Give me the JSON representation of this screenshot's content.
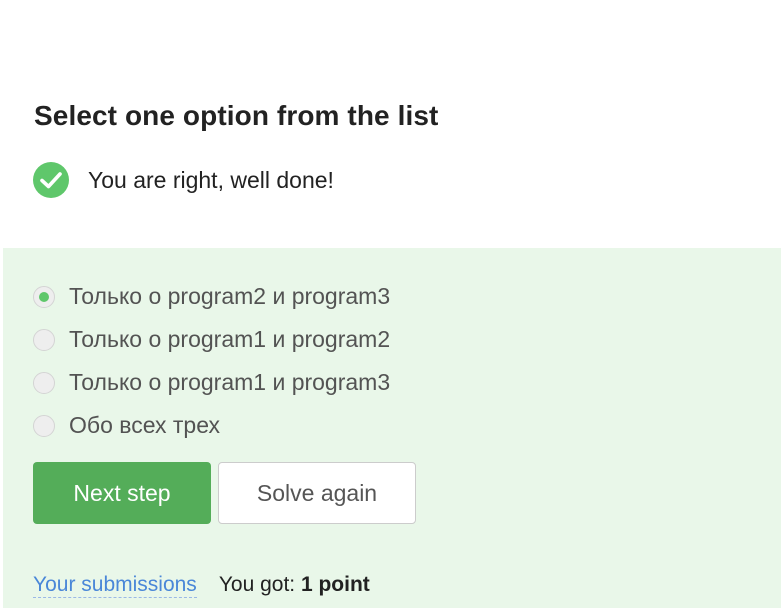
{
  "quiz": {
    "title": "Select one option from the list",
    "feedback": "You are right, well done!",
    "options": [
      {
        "label": "Только о program2 и program3",
        "selected": true
      },
      {
        "label": "Только о program1 и program2",
        "selected": false
      },
      {
        "label": "Только о program1 и program3",
        "selected": false
      },
      {
        "label": "Обо всех трех",
        "selected": false
      }
    ]
  },
  "actions": {
    "next_step": "Next step",
    "solve_again": "Solve again"
  },
  "footer": {
    "submissions_link": "Your submissions",
    "score_prefix": "You got:",
    "score_value": "1 point"
  },
  "colors": {
    "success": "#5fc76b",
    "panel_background": "#e9f7e9",
    "primary_button": "#54ad59",
    "link": "#4a87d8"
  },
  "icons": {
    "feedback": "check-circle-icon"
  }
}
